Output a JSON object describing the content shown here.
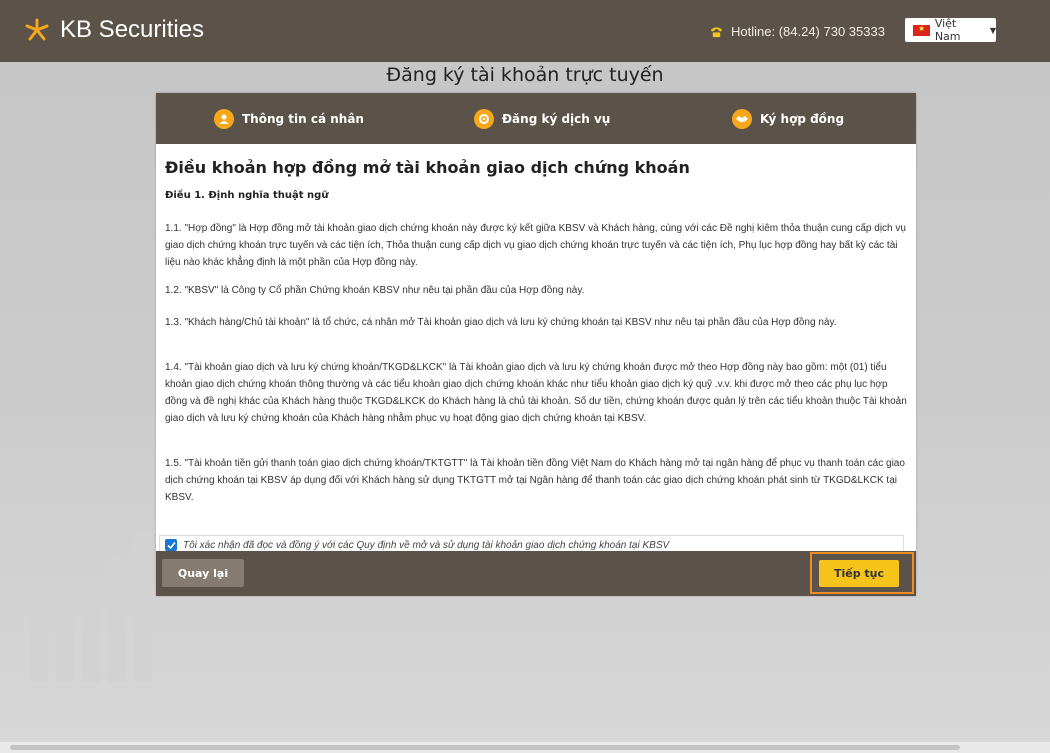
{
  "header": {
    "brand": "KB Securities",
    "hotline": "Hotline: (84.24) 730 35333",
    "language": "Việt Nam"
  },
  "page_title": "Đăng ký tài khoản trực tuyến",
  "steps": [
    {
      "label": "Thông tin cá nhân",
      "icon": "user-icon"
    },
    {
      "label": "Đăng ký dịch vụ",
      "icon": "service-icon"
    },
    {
      "label": "Ký hợp đồng",
      "icon": "handshake-icon"
    }
  ],
  "terms": {
    "title": "Điều khoản hợp đồng mở tài khoản giao dịch chứng khoán",
    "article": "Điều 1. Định nghĩa thuật ngữ",
    "p1": "1.1. \"Hợp đồng\" là Hợp đồng mở tài khoản giao dịch chứng khoán này được ký kết giữa KBSV và Khách hàng, cùng với các Đề nghị kiêm thỏa thuận cung cấp dịch vụ giao dịch chứng khoán trực tuyến và các tiện ích, Thỏa thuận cung cấp dịch vụ giao dịch chứng khoán trực tuyến và các tiện ích, Phụ lục hợp đồng hay bất kỳ các tài liệu nào khác khẳng định là một phần của Hợp đồng này.",
    "p2": "1.2. \"KBSV\" là Công ty Cổ phần Chứng khoán KBSV như nêu tại phần đầu của Hợp đồng này.",
    "p3": "1.3. \"Khách hàng/Chủ tài khoản\" là tổ chức, cá nhân mở Tài khoản giao dịch và lưu ký chứng khoán tại KBSV như nêu tại phần đầu của Hợp đồng này.",
    "p4": "1.4. \"Tài khoản giao dịch và lưu ký chứng khoán/TKGD&LKCK\" là Tài khoản giao dịch và lưu ký chứng khoán được mở theo Hợp đồng này bao gồm: một (01) tiểu khoản giao dịch chứng khoán thông thường và các tiểu khoản giao dịch chứng khoán khác như tiểu khoản giao dịch ký quỹ .v.v. khi được mở theo các phụ lục hợp đồng và đề nghị khác của Khách hàng thuộc TKGD&LKCK do Khách hàng là chủ tài khoản. Số dư tiền, chứng khoán được quản lý trên các tiểu khoản thuộc Tài khoản giao dịch và lưu ký chứng khoán của Khách hàng nhằm phục vụ hoạt động giao dịch chứng khoán tại KBSV.",
    "p5": "1.5. \"Tài khoản tiền gửi thanh toán giao dịch chứng khoán/TKTGTT\" là Tài khoản tiền đồng Việt Nam do Khách hàng mở tại ngân hàng để phục vụ thanh toán các giao dịch chứng khoán tại KBSV áp dụng đối với Khách hàng sử dụng TKTGTT mở tại Ngân hàng để thanh toán các giao dịch chứng khoán phát sinh từ TKGD&LKCK tại KBSV."
  },
  "confirm": {
    "checked": true,
    "label": "Tôi xác nhận đã đọc và đồng ý với các Quy định về mở và sử dụng tài khoản giao dịch chứng khoán tại KBSV"
  },
  "buttons": {
    "back": "Quay lại",
    "next": "Tiếp tục"
  },
  "colors": {
    "header_bg": "#5b5249",
    "accent": "#f7a71b",
    "next_button": "#f5c31a",
    "highlight_border": "#ef8c24"
  }
}
